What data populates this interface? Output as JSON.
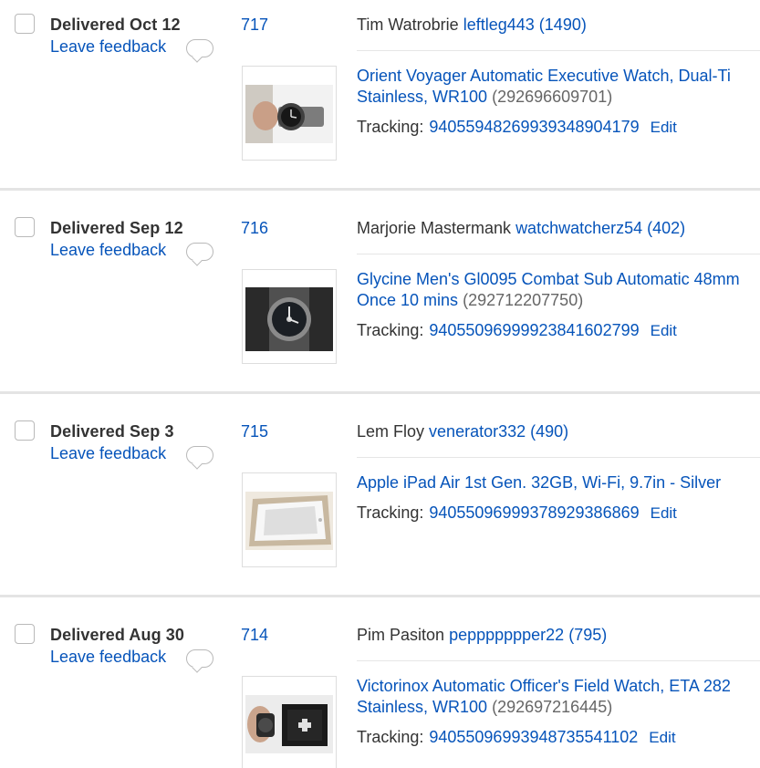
{
  "orders": [
    {
      "status": "Delivered Oct 12",
      "feedback": "Leave feedback",
      "order_number": "717",
      "buyer_name": "Tim Watrobrie",
      "buyer_id": "leftleg443",
      "buyer_score": "(1490)",
      "title_line1": "Orient Voyager Automatic Executive Watch, Dual-Ti",
      "title_line2": "Stainless, WR100",
      "item_number": "(292696609701)",
      "tracking_label": "Tracking:",
      "tracking_number": "94055948269939348904179",
      "edit": "Edit"
    },
    {
      "status": "Delivered Sep 12",
      "feedback": "Leave feedback",
      "order_number": "716",
      "buyer_name": "Marjorie Mastermank",
      "buyer_id": "watchwatcherz54",
      "buyer_score": "(402)",
      "title_line1": "Glycine Men's Gl0095 Combat Sub Automatic 48mm",
      "title_line2": "Once 10 mins",
      "item_number": "(292712207750)",
      "tracking_label": "Tracking:",
      "tracking_number": "94055096999923841602799",
      "edit": "Edit"
    },
    {
      "status": "Delivered Sep 3",
      "feedback": "Leave feedback",
      "order_number": "715",
      "buyer_name": "Lem Floy",
      "buyer_id": "venerator332",
      "buyer_score": "(490)",
      "title_line1": "Apple iPad Air 1st Gen. 32GB, Wi-Fi, 9.7in - Silver",
      "title_line2": "",
      "item_number": "",
      "tracking_label": "Tracking:",
      "tracking_number": "94055096999378929386869",
      "edit": "Edit"
    },
    {
      "status": "Delivered Aug 30",
      "feedback": "Leave feedback",
      "order_number": "714",
      "buyer_name": "Pim Pasiton",
      "buyer_id": "peppppppper22",
      "buyer_score": "(795)",
      "title_line1": "Victorinox Automatic Officer's Field Watch, ETA 282",
      "title_line2": "Stainless, WR100",
      "item_number": "(292697216445)",
      "tracking_label": "Tracking:",
      "tracking_number": "94055096993948735541102",
      "edit": "Edit"
    }
  ]
}
